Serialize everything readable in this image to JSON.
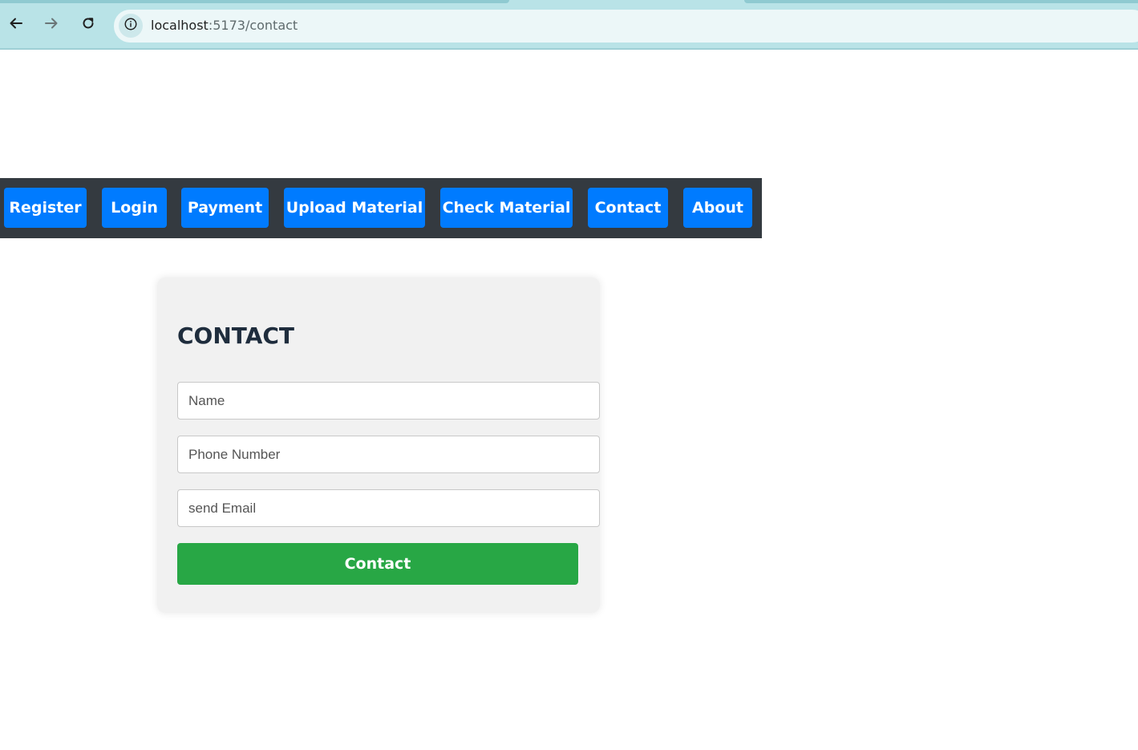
{
  "browser": {
    "url_host": "localhost",
    "url_rest": ":5173/contact",
    "icons": {
      "back": "arrow-left-icon",
      "forward": "arrow-right-icon",
      "reload": "reload-icon",
      "site_info": "info-icon"
    }
  },
  "navbar": {
    "items": [
      {
        "label": "Register"
      },
      {
        "label": "Login"
      },
      {
        "label": "Payment"
      },
      {
        "label": "Upload Material"
      },
      {
        "label": "Check Material"
      },
      {
        "label": "Contact"
      },
      {
        "label": "About"
      }
    ]
  },
  "contact_form": {
    "title": "CONTACT",
    "name_placeholder": "Name",
    "phone_placeholder": "Phone Number",
    "email_placeholder": "send Email",
    "submit_label": "Contact"
  },
  "colors": {
    "navbar_bg": "#343a40",
    "nav_button": "#007bff",
    "submit_button": "#28a745",
    "card_bg": "#f1f1f1"
  }
}
